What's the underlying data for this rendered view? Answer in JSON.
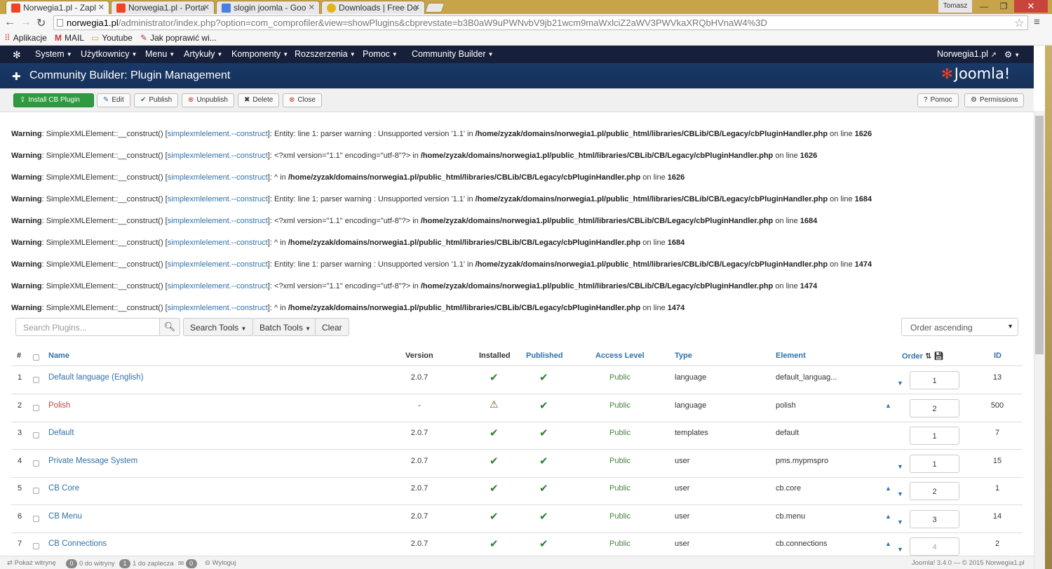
{
  "browser": {
    "tabs": [
      {
        "title": "Norwegia1.pl - Zapl",
        "favicon_color": "#f44321"
      },
      {
        "title": "Norwegia1.pl - Porta",
        "favicon_color": "#f44321"
      },
      {
        "title": "slogin joomla - Goo",
        "favicon_color": "#4a7fe0"
      },
      {
        "title": "Downloads | Free Do",
        "favicon_color": "#e3b31c"
      }
    ],
    "user": "Tomasz",
    "url_host": "norwegia1.pl",
    "url_rest": "/administrator/index.php?option=com_comprofiler&view=showPlugins&cbprevstate=b3B0aW9uPWNvbV9jb21wcm9maWxlciZ2aWV3PWVkaXRQbHVnaW4%3D",
    "bookmarks": [
      "Aplikacje",
      "MAIL",
      "Youtube",
      "Jak poprawić wi..."
    ]
  },
  "nav": {
    "items": [
      "System",
      "Użytkownicy",
      "Menu",
      "Artykuły",
      "Komponenty",
      "Rozszerzenia",
      "Pomoc",
      "Community Builder"
    ],
    "site": "Norwegia1.pl"
  },
  "header": {
    "title": "Community Builder: Plugin Management",
    "brand": "Joomla!"
  },
  "toolbar": {
    "install": "Install CB Plugin",
    "edit": "Edit",
    "publish": "Publish",
    "unpublish": "Unpublish",
    "delete": "Delete",
    "close": "Close",
    "help": "Pomoc",
    "permissions": "Permissions"
  },
  "warnings": [
    {
      "label": "Warning",
      "fn": "SimpleXMLElement::__construct()",
      "link": "simplexmlelement.--construct",
      "msg": "Entity: line 1: parser warning : Unsupported version '1.1' in ",
      "file": "/home/zyzak/domains/norwegia1.pl/public_html/libraries/CBLib/CB/Legacy/cbPluginHandler.php",
      "on": " on line ",
      "line": "1626"
    },
    {
      "label": "Warning",
      "fn": "SimpleXMLElement::__construct()",
      "link": "simplexmlelement.--construct",
      "msg": "<?xml version=\"1.1\" encoding=\"utf-8\"?> in ",
      "file": "/home/zyzak/domains/norwegia1.pl/public_html/libraries/CBLib/CB/Legacy/cbPluginHandler.php",
      "on": " on line ",
      "line": "1626"
    },
    {
      "label": "Warning",
      "fn": "SimpleXMLElement::__construct()",
      "link": "simplexmlelement.--construct",
      "msg": "^ in ",
      "file": "/home/zyzak/domains/norwegia1.pl/public_html/libraries/CBLib/CB/Legacy/cbPluginHandler.php",
      "on": " on line ",
      "line": "1626"
    },
    {
      "label": "Warning",
      "fn": "SimpleXMLElement::__construct()",
      "link": "simplexmlelement.--construct",
      "msg": "Entity: line 1: parser warning : Unsupported version '1.1' in ",
      "file": "/home/zyzak/domains/norwegia1.pl/public_html/libraries/CBLib/CB/Legacy/cbPluginHandler.php",
      "on": " on line ",
      "line": "1684"
    },
    {
      "label": "Warning",
      "fn": "SimpleXMLElement::__construct()",
      "link": "simplexmlelement.--construct",
      "msg": "<?xml version=\"1.1\" encoding=\"utf-8\"?> in ",
      "file": "/home/zyzak/domains/norwegia1.pl/public_html/libraries/CBLib/CB/Legacy/cbPluginHandler.php",
      "on": " on line ",
      "line": "1684"
    },
    {
      "label": "Warning",
      "fn": "SimpleXMLElement::__construct()",
      "link": "simplexmlelement.--construct",
      "msg": "^ in ",
      "file": "/home/zyzak/domains/norwegia1.pl/public_html/libraries/CBLib/CB/Legacy/cbPluginHandler.php",
      "on": " on line ",
      "line": "1684"
    },
    {
      "label": "Warning",
      "fn": "SimpleXMLElement::__construct()",
      "link": "simplexmlelement.--construct",
      "msg": "Entity: line 1: parser warning : Unsupported version '1.1' in ",
      "file": "/home/zyzak/domains/norwegia1.pl/public_html/libraries/CBLib/CB/Legacy/cbPluginHandler.php",
      "on": " on line ",
      "line": "1474"
    },
    {
      "label": "Warning",
      "fn": "SimpleXMLElement::__construct()",
      "link": "simplexmlelement.--construct",
      "msg": "<?xml version=\"1.1\" encoding=\"utf-8\"?> in ",
      "file": "/home/zyzak/domains/norwegia1.pl/public_html/libraries/CBLib/CB/Legacy/cbPluginHandler.php",
      "on": " on line ",
      "line": "1474"
    },
    {
      "label": "Warning",
      "fn": "SimpleXMLElement::__construct()",
      "link": "simplexmlelement.--construct",
      "msg": "^ in ",
      "file": "/home/zyzak/domains/norwegia1.pl/public_html/libraries/CBLib/CB/Legacy/cbPluginHandler.php",
      "on": " on line ",
      "line": "1474"
    }
  ],
  "filters": {
    "search_placeholder": "Search Plugins...",
    "search_tools": "Search Tools",
    "batch_tools": "Batch Tools",
    "clear": "Clear",
    "order": "Order ascending"
  },
  "table": {
    "headers": {
      "num": "#",
      "name": "Name",
      "version": "Version",
      "installed": "Installed",
      "published": "Published",
      "access": "Access Level",
      "type": "Type",
      "element": "Element",
      "order": "Order",
      "id": "ID"
    },
    "rows": [
      {
        "num": "1",
        "name": "Default language (English)",
        "version": "2.0.7",
        "installed": "check",
        "published": "check",
        "access": "Public",
        "type": "language",
        "element": "default_languag...",
        "order": "1",
        "id": "13",
        "up": false,
        "down": true,
        "red": false
      },
      {
        "num": "2",
        "name": "Polish",
        "version": "-",
        "installed": "warning",
        "published": "check",
        "access": "Public",
        "type": "language",
        "element": "polish",
        "order": "2",
        "id": "500",
        "up": true,
        "down": false,
        "red": true
      },
      {
        "num": "3",
        "name": "Default",
        "version": "2.0.7",
        "installed": "check",
        "published": "check",
        "access": "Public",
        "type": "templates",
        "element": "default",
        "order": "1",
        "id": "7",
        "up": false,
        "down": false,
        "red": false
      },
      {
        "num": "4",
        "name": "Private Message System",
        "version": "2.0.7",
        "installed": "check",
        "published": "check",
        "access": "Public",
        "type": "user",
        "element": "pms.mypmspro",
        "order": "1",
        "id": "15",
        "up": false,
        "down": true,
        "red": false
      },
      {
        "num": "5",
        "name": "CB Core",
        "version": "2.0.7",
        "installed": "check",
        "published": "check",
        "access": "Public",
        "type": "user",
        "element": "cb.core",
        "order": "2",
        "id": "1",
        "up": true,
        "down": true,
        "red": false
      },
      {
        "num": "6",
        "name": "CB Menu",
        "version": "2.0.7",
        "installed": "check",
        "published": "check",
        "access": "Public",
        "type": "user",
        "element": "cb.menu",
        "order": "3",
        "id": "14",
        "up": true,
        "down": true,
        "red": false
      },
      {
        "num": "7",
        "name": "CB Connections",
        "version": "2.0.7",
        "installed": "check",
        "published": "check",
        "access": "Public",
        "type": "user",
        "element": "cb.connections",
        "order": "4",
        "id": "2",
        "up": true,
        "down": true,
        "red": false
      }
    ]
  },
  "footer": {
    "show_site": "Pokaż witrynę",
    "site_count": "0",
    "site_label": "0 do witryny",
    "admin_count": "1",
    "admin_label": "1 do zaplecza",
    "msg_count": "0",
    "logout": "Wyloguj",
    "version": "Joomla! 3.4.0 — © 2015 Norwegia1.pl"
  }
}
